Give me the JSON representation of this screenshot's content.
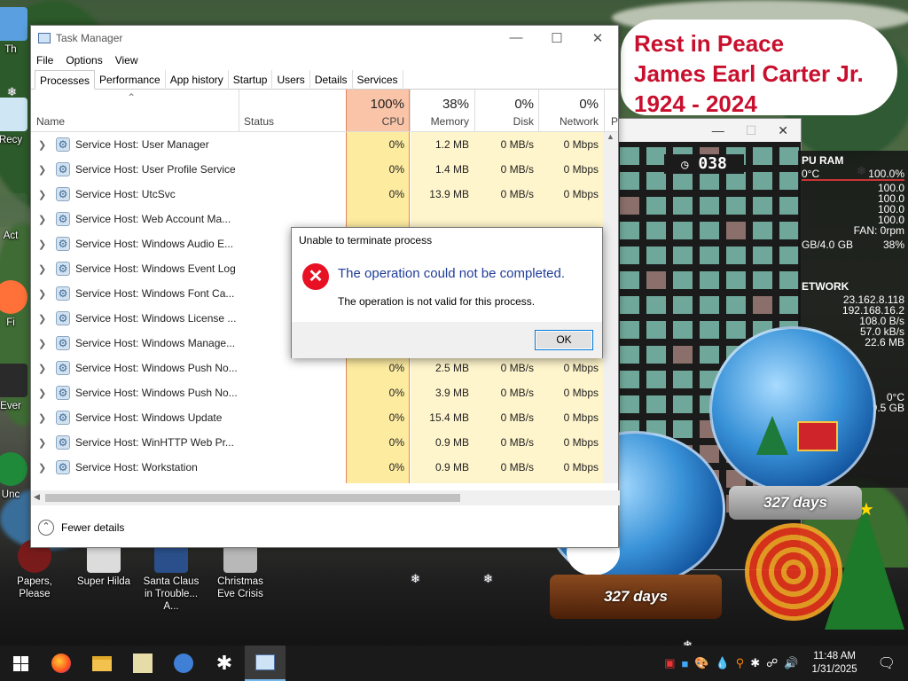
{
  "desktop": {
    "banner": {
      "line1": "Rest in Peace",
      "line2": "James Earl Carter Jr.",
      "line3": "1924 - 2024"
    },
    "icons": [
      {
        "label": "Papers, Please",
        "color": "#7a1b1b"
      },
      {
        "label": "Super Hilda",
        "color": "#dcdcdc"
      },
      {
        "label": "Santa Claus in Trouble... A...",
        "color": "#2a4f8a"
      },
      {
        "label": "Christmas Eve Crisis",
        "color": "#b8b8b8"
      }
    ],
    "partial_labels": {
      "a": "Th",
      "b": "Recy",
      "c": "Act",
      "d": "Fi",
      "e": "Ever",
      "f": "Unc"
    },
    "globe_left_label": "327 days",
    "globe_right_label": "327 days",
    "game_clock": "038",
    "monitor": {
      "cpu_header": "PU RAM",
      "temp": "0°C",
      "cpu_pct": "100.0%",
      "core_pcts": [
        "100.0",
        "100.0",
        "100.0",
        "100.0"
      ],
      "fan": "FAN: 0rpm",
      "ram": "GB/4.0 GB",
      "ram_pct": "38%",
      "net_header": "ETWORK",
      "ip1": "23.162.8.118",
      "ip2": "192.168.16.2",
      "rate1": "108.0 B/s",
      "rate2": "57.0 kB/s",
      "rate3": "22.6 MB",
      "temp2": "0°C",
      "disk": "9.5 GB"
    }
  },
  "taskmanager": {
    "title": "Task Manager",
    "menu": [
      "File",
      "Options",
      "View"
    ],
    "tabs": [
      "Processes",
      "Performance",
      "App history",
      "Startup",
      "Users",
      "Details",
      "Services"
    ],
    "active_tab": "Processes",
    "columns": {
      "name": "Name",
      "status": "Status",
      "cpu": {
        "pct": "100%",
        "label": "CPU"
      },
      "memory": {
        "pct": "38%",
        "label": "Memory"
      },
      "disk": {
        "pct": "0%",
        "label": "Disk"
      },
      "network": {
        "pct": "0%",
        "label": "Network"
      },
      "power": "P"
    },
    "rows": [
      {
        "name": "Service Host: User Manager",
        "cpu": "0%",
        "memory": "1.2 MB",
        "disk": "0 MB/s",
        "network": "0 Mbps"
      },
      {
        "name": "Service Host: User Profile Service",
        "cpu": "0%",
        "memory": "1.4 MB",
        "disk": "0 MB/s",
        "network": "0 Mbps"
      },
      {
        "name": "Service Host: UtcSvc",
        "cpu": "0%",
        "memory": "13.9 MB",
        "disk": "0 MB/s",
        "network": "0 Mbps"
      },
      {
        "name": "Service Host: Web Account Ma...",
        "cpu": "",
        "memory": "",
        "disk": "",
        "network": ""
      },
      {
        "name": "Service Host: Windows Audio E...",
        "cpu": "",
        "memory": "",
        "disk": "",
        "network": ""
      },
      {
        "name": "Service Host: Windows Event Log",
        "cpu": "",
        "memory": "",
        "disk": "",
        "network": ""
      },
      {
        "name": "Service Host: Windows Font Ca...",
        "cpu": "",
        "memory": "",
        "disk": "",
        "network": ""
      },
      {
        "name": "Service Host: Windows License ...",
        "cpu": "",
        "memory": "",
        "disk": "",
        "network": ""
      },
      {
        "name": "Service Host: Windows Manage...",
        "cpu": "",
        "memory": "",
        "disk": "",
        "network": ""
      },
      {
        "name": "Service Host: Windows Push No...",
        "cpu": "0%",
        "memory": "2.5 MB",
        "disk": "0 MB/s",
        "network": "0 Mbps"
      },
      {
        "name": "Service Host: Windows Push No...",
        "cpu": "0%",
        "memory": "3.9 MB",
        "disk": "0 MB/s",
        "network": "0 Mbps"
      },
      {
        "name": "Service Host: Windows Update",
        "cpu": "0%",
        "memory": "15.4 MB",
        "disk": "0 MB/s",
        "network": "0 Mbps"
      },
      {
        "name": "Service Host: WinHTTP Web Pr...",
        "cpu": "0%",
        "memory": "0.9 MB",
        "disk": "0 MB/s",
        "network": "0 Mbps"
      },
      {
        "name": "Service Host: Workstation",
        "cpu": "0%",
        "memory": "0.9 MB",
        "disk": "0 MB/s",
        "network": "0 Mbps"
      }
    ],
    "fewer_details": "Fewer details"
  },
  "dialog": {
    "title": "Unable to terminate process",
    "message": "The operation could not be completed.",
    "detail": "The operation is not valid for this process.",
    "ok_label": "OK"
  },
  "taskbar": {
    "time": "11:48 AM",
    "date": "1/31/2025",
    "pinned_icons": [
      "windows-logo-icon",
      "firefox-icon",
      "file-explorer-icon",
      "game-icon",
      "people-icon",
      "snowflake-icon",
      "task-manager-icon"
    ]
  },
  "colors": {
    "cpu_header_bg": "#f9c4a8",
    "cpu_column_bg": "#fdeba0",
    "error_red": "#e81123",
    "dialog_heading": "#1f3d99",
    "banner_red": "#c8102e"
  }
}
